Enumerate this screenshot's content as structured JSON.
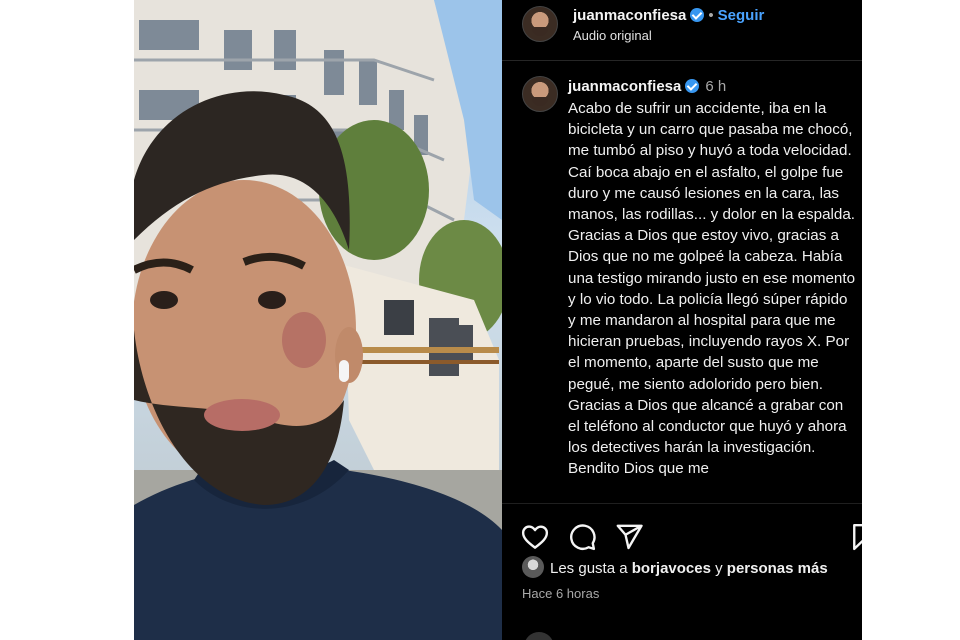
{
  "header": {
    "username": "juanmaconfiesa",
    "separator": "•",
    "follow_label": "Seguir",
    "subtitle": "Audio original"
  },
  "caption": {
    "username": "juanmaconfiesa",
    "time": "6 h",
    "text": "Acabo de sufrir un accidente, iba en la bicicleta y un carro que pasaba me chocó, me tumbó al piso y huyó a toda velocidad. Caí boca abajo en el asfalto, el golpe fue duro y me causó lesiones en la cara, las manos, las rodillas... y dolor en la espalda. Gracias a Dios que estoy vivo, gracias a Dios que no me golpeé la cabeza. Había una testigo mirando justo en ese momento y lo vio todo. La policía llegó súper rápido y me mandaron al hospital para que me hicieran pruebas, incluyendo rayos X. Por el momento, aparte del susto que me pegué, me siento adolorido pero bien. Gracias a Dios que alcancé a grabar con el teléfono al conductor que huyó y ahora los detectives harán la investigación. Bendito Dios que me"
  },
  "likes": {
    "prefix": "Les gusta a",
    "user": "borjavoces",
    "joiner": "y",
    "others": "personas más",
    "time": "Hace 6 horas"
  },
  "icons": {
    "like": "heart-icon",
    "comment": "comment-icon",
    "share": "paper-plane-icon",
    "save": "bookmark-icon",
    "verified": "verified-badge-icon"
  },
  "colors": {
    "panel_bg": "#000000",
    "follow": "#4aa3ff",
    "verified": "#3897f0",
    "muted_text": "#a8a8a8"
  }
}
